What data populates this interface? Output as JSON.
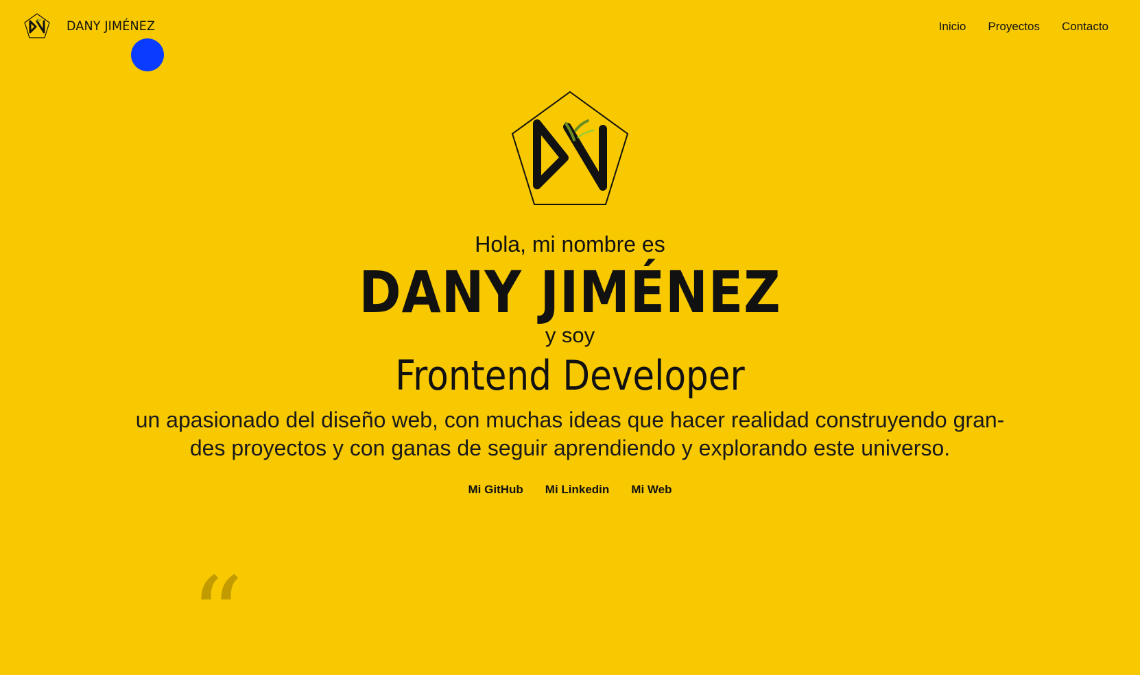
{
  "header": {
    "brand_name": "DANY JIMÉNEZ",
    "nav": [
      {
        "label": "Inicio"
      },
      {
        "label": "Proyectos"
      },
      {
        "label": "Contacto"
      }
    ]
  },
  "hero": {
    "greeting": "Hola, mi nombre es",
    "name": "DANY JIMÉNEZ",
    "and": "y soy",
    "role": "Frontend Developer",
    "bio_line1": "un apasionado del diseño web, con muchas ideas que hacer realidad construyendo gran-",
    "bio_line2": "des proyectos y con ganas de seguir aprendiendo y explorando este universo.",
    "links": [
      {
        "label": "Mi GitHub"
      },
      {
        "label": "Mi Linkedin"
      },
      {
        "label": "Mi Web"
      }
    ]
  },
  "decor": {
    "quote_mark": "“"
  },
  "colors": {
    "background": "#F8C900",
    "text": "#111111",
    "cursor_dot": "#0A3CFF",
    "logo_accent": "#6B8E23"
  }
}
